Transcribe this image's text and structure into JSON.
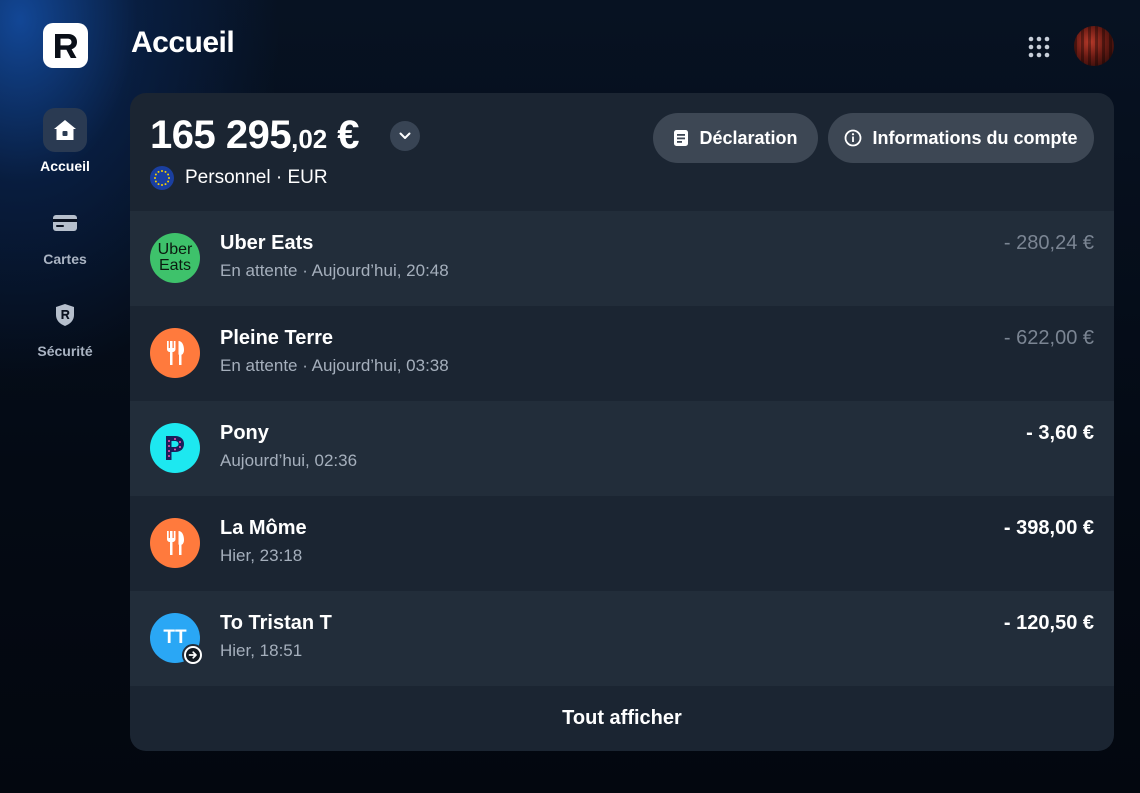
{
  "app": {
    "logo_letter": "R"
  },
  "sidebar": {
    "items": [
      {
        "label": "Accueil",
        "icon": "home-icon",
        "active": true
      },
      {
        "label": "Cartes",
        "icon": "card-icon",
        "active": false
      },
      {
        "label": "Sécurité",
        "icon": "shield-icon",
        "active": false
      }
    ]
  },
  "header": {
    "title": "Accueil"
  },
  "account": {
    "balance_main": "165 295",
    "balance_cents": ",02",
    "currency_symbol": "€",
    "name": "Personnel · EUR"
  },
  "actions": {
    "declaration_label": "Déclaration",
    "info_label": "Informations du compte"
  },
  "transactions": [
    {
      "name": "Uber Eats",
      "subtitle": "En attente · Aujourd’hui, 20:48",
      "amount": "- 280,24 €",
      "pending": true,
      "logo": "uber-eats-logo",
      "logo_text_1": "Uber",
      "logo_text_2": "Eats",
      "color": "#3ec26b"
    },
    {
      "name": "Pleine Terre",
      "subtitle": "En attente · Aujourd’hui, 03:38",
      "amount": "- 622,00 €",
      "pending": true,
      "logo": "fork-knife-icon",
      "color": "#ff7a3d"
    },
    {
      "name": "Pony",
      "subtitle": "Aujourd’hui, 02:36",
      "amount": "- 3,60 €",
      "pending": false,
      "logo": "pony-logo",
      "color": "#1de8f0"
    },
    {
      "name": "La Môme",
      "subtitle": "Hier, 23:18",
      "amount": "- 398,00 €",
      "pending": false,
      "logo": "fork-knife-icon",
      "color": "#ff7a3d"
    },
    {
      "name": "To Tristan T",
      "subtitle": "Hier, 18:51",
      "amount": "- 120,50 €",
      "pending": false,
      "logo": "initials-avatar",
      "initials": "TT",
      "color": "#2aa7f5"
    }
  ],
  "footer": {
    "show_all_label": "Tout afficher"
  },
  "colors": {
    "background": "#040a14",
    "card": "#1b2532",
    "row_alt": "#222d3a",
    "pill": "#3d4754",
    "pending_amount": "#7b8593"
  }
}
